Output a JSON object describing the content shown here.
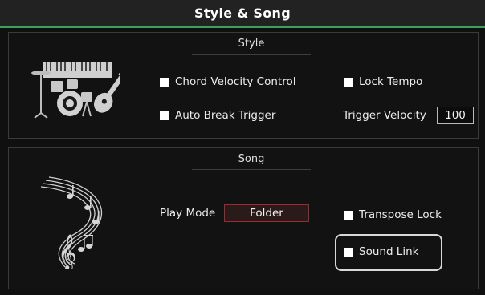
{
  "header": {
    "title": "Style & Song"
  },
  "style_section": {
    "title": "Style",
    "icon": "band-instruments-icon",
    "chord_velocity_control": {
      "label": "Chord Velocity Control",
      "checked": true
    },
    "lock_tempo": {
      "label": "Lock Tempo",
      "checked": true
    },
    "auto_break_trigger": {
      "label": "Auto Break Trigger",
      "checked": true
    },
    "trigger_velocity": {
      "label": "Trigger Velocity",
      "value": "100"
    }
  },
  "song_section": {
    "title": "Song",
    "icon": "music-notes-icon",
    "play_mode": {
      "label": "Play Mode",
      "value": "Folder"
    },
    "transpose_lock": {
      "label": "Transpose Lock",
      "checked": true
    },
    "sound_link": {
      "label": "Sound Link",
      "checked": true,
      "highlighted": true
    }
  },
  "colors": {
    "accent_green": "#3aa25a",
    "folder_border": "#9c2b2b",
    "checkbox": "#ffffff"
  }
}
